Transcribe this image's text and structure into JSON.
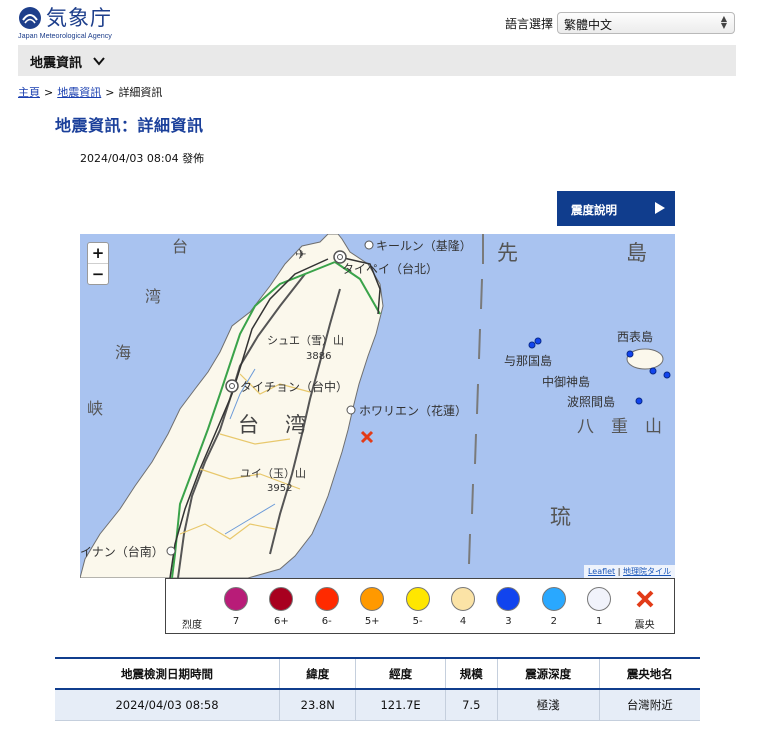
{
  "header": {
    "logo_title": "気象庁",
    "logo_subtitle": "Japan Meteorological Agency",
    "lang_label": "語言選擇",
    "lang_value": "繁體中文"
  },
  "menu": {
    "label": "地震資訊"
  },
  "breadcrumb": {
    "home": "主頁",
    "section": "地震資訊",
    "current": "詳細資訊",
    "separator": ">"
  },
  "page": {
    "title": "地震資訊：詳細資訊",
    "issued": "2024/04/03 08:04 發佈",
    "intensity_button": "震度說明"
  },
  "map": {
    "zoom_in": "+",
    "zoom_out": "−",
    "labels": {
      "keelung": "キールン（基隆）",
      "taipei": "タイペイ（台北）",
      "sakishima": "先",
      "shima": "島",
      "shue": "シュエ（雪）山",
      "shue_elev": "3886",
      "taichung": "タイチョン（台中）",
      "hualien": "ホワリエン（花蓮）",
      "taiwan_1": "台",
      "taiwan_2": "湾",
      "yushan": "ユイ（玉）山",
      "yushan_elev": "3952",
      "tainan": "イナン（台南）",
      "yonaguni": "与那国島",
      "iriomote": "西表島",
      "nakanougan": "中御神島",
      "hateruma": "波照間島",
      "yaeyama": "八　重　山　列",
      "ryukyu": "琉",
      "strait_1": "台",
      "strait_2": "湾",
      "strait_3": "海",
      "strait_4": "峡"
    },
    "attribution_link": "Leaflet",
    "attribution_sep": "|",
    "attribution_tiles": "地理院タイル"
  },
  "legend": {
    "prefix": "烈度",
    "items": [
      {
        "label": "7",
        "color": "#b81c78"
      },
      {
        "label": "6+",
        "color": "#a8001f"
      },
      {
        "label": "6-",
        "color": "#ff2a00"
      },
      {
        "label": "5+",
        "color": "#ff9900"
      },
      {
        "label": "5-",
        "color": "#ffe600"
      },
      {
        "label": "4",
        "color": "#fbe3a6"
      },
      {
        "label": "3",
        "color": "#1144ee"
      },
      {
        "label": "2",
        "color": "#29a8ff"
      },
      {
        "label": "1",
        "color": "#f1f3fb"
      },
      {
        "label": "震央",
        "color": "#e23b18",
        "icon": "epicenter-x-icon"
      }
    ]
  },
  "table": {
    "headers": [
      "地震檢測日期時間",
      "緯度",
      "經度",
      "規模",
      "震源深度",
      "震央地名"
    ],
    "rows": [
      [
        "2024/04/03 08:58",
        "23.8N",
        "121.7E",
        "7.5",
        "極淺",
        "台灣附近"
      ]
    ]
  },
  "colors": {
    "accent": "#103d8d",
    "title": "#1a3f9a",
    "sea": "#a9c3f0",
    "land": "#fbf8ec",
    "epicenter": "#e23b18",
    "station": "#1144ee"
  }
}
